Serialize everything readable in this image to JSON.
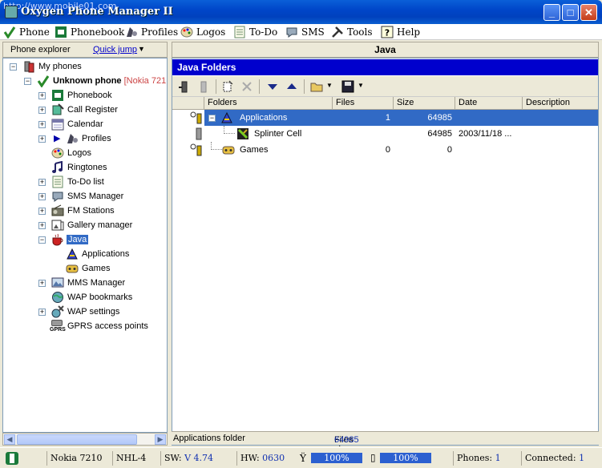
{
  "window": {
    "title": "Oxygen Phone Manager II",
    "watermark": "http://www.mobile01.com",
    "buttons": {
      "minimize": "_",
      "maximize": "□",
      "close": "✕"
    }
  },
  "menu": [
    {
      "label": "Phone",
      "icon": "phone-check-icon"
    },
    {
      "label": "Phonebook",
      "icon": "phonebook-icon"
    },
    {
      "label": "Profiles",
      "icon": "profiles-icon"
    },
    {
      "label": "Logos",
      "icon": "palette-icon"
    },
    {
      "label": "To-Do",
      "icon": "todo-icon"
    },
    {
      "label": "SMS",
      "icon": "sms-icon"
    },
    {
      "label": "Tools",
      "icon": "tools-icon"
    },
    {
      "label": "Help",
      "icon": "help-icon"
    }
  ],
  "left_pane": {
    "header": "Phone explorer",
    "quick_jump": "Quick jump",
    "tree": {
      "root": "My phones",
      "phone": "Unknown phone",
      "phone_model": "[Nokia 721",
      "items": [
        "Phonebook",
        "Call Register",
        "Calendar",
        "Profiles",
        "Logos",
        "Ringtones",
        "To-Do list",
        "SMS Manager",
        "FM Stations",
        "Gallery manager",
        "Java",
        "Applications",
        "Games",
        "MMS Manager",
        "WAP bookmarks",
        "WAP settings",
        "GPRS access points"
      ],
      "gprs_icon_text": "GPRS"
    }
  },
  "right_pane": {
    "header": "Java",
    "section_title": "Java Folders",
    "columns": [
      "Folders",
      "Files",
      "Size",
      "Date",
      "Description"
    ],
    "rows": [
      {
        "name": "Applications",
        "files": "1",
        "size": "64985",
        "date": "",
        "description": "",
        "selected": true,
        "expander": "−"
      },
      {
        "name": "Splinter Cell",
        "files": "",
        "size": "64985",
        "date": "2003/11/18 ...",
        "description": "",
        "selected": false,
        "expander": ""
      },
      {
        "name": "Games",
        "files": "0",
        "size": "0",
        "date": "",
        "description": "",
        "selected": false,
        "expander": ""
      }
    ],
    "status_left": "Applications folder",
    "status_files_size_label": "Files size:",
    "status_files_size_value": "64985"
  },
  "statusbar": {
    "model": "Nokia 7210",
    "code": "NHL-4",
    "sw_label": "SW:",
    "sw_value": "V 4.74",
    "hw_label": "HW:",
    "hw_value": "0630",
    "signal": "100%",
    "battery": "100%",
    "signal_level": 1.0,
    "battery_level": 1.0,
    "phones_label": "Phones:",
    "phones_value": "1",
    "connected_label": "Connected:",
    "connected_value": "1"
  }
}
